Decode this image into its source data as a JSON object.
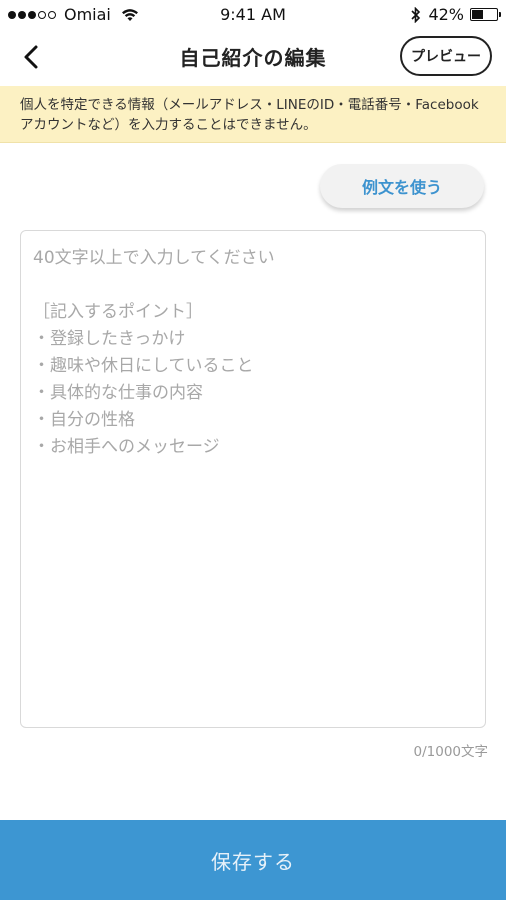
{
  "status_bar": {
    "carrier": "Omiai",
    "time": "9:41 AM",
    "battery": "42%",
    "battery_level": 0.42,
    "icons": [
      "signal-dots-icon",
      "wifi-icon",
      "bluetooth-icon",
      "battery-icon"
    ]
  },
  "nav": {
    "back_icon": "chevron-left-icon",
    "title": "自己紹介の編集",
    "preview_label": "プレビュー"
  },
  "notice": {
    "text": "個人を特定できる情報（メールアドレス・LINEのID・電話番号・Facebookアカウントなど）を入力することはできません。"
  },
  "example_button": {
    "label": "例文を使う"
  },
  "editor": {
    "value": "",
    "placeholder_lines": [
      "40文字以上で入力してください",
      "",
      "［記入するポイント］",
      "・登録したきっかけ",
      "・趣味や休日にしていること",
      "・具体的な仕事の内容",
      "・自分の性格",
      "・お相手へのメッセージ"
    ]
  },
  "counter": {
    "text": "0/1000文字"
  },
  "save_button": {
    "label": "保存する"
  },
  "colors": {
    "accent": "#3d96d2",
    "notice_bg": "#fcf1c3",
    "example_text": "#3d93cf",
    "placeholder": "#a8a8a8"
  }
}
